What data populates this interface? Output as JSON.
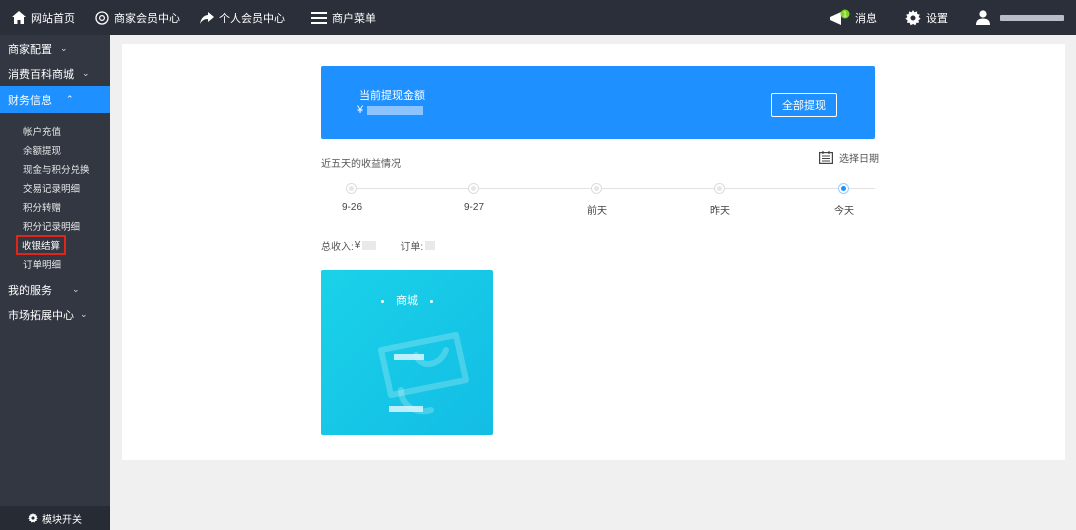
{
  "topbar": {
    "home": "网站首页",
    "merchant_center": "商家会员中心",
    "personal_center": "个人会员中心",
    "merchant_menu": "商户菜单",
    "messages": "消息",
    "settings": "设置"
  },
  "sidebar": {
    "groups": [
      {
        "label": "商家配置"
      },
      {
        "label": "消费百科商城"
      },
      {
        "label": "财务信息"
      },
      {
        "label": "我的服务"
      },
      {
        "label": "市场拓展中心"
      }
    ],
    "finance_items": [
      "帐户充值",
      "余额提现",
      "现金与积分兑换",
      "交易记录明细",
      "积分转赠",
      "积分记录明细",
      "收银结算",
      "订单明细"
    ],
    "module_switch": "模块开关"
  },
  "balance": {
    "label": "当前提现金额",
    "currency": "¥",
    "withdraw_all": "全部提现"
  },
  "earnings": {
    "title": "近五天的收益情况",
    "select_date": "选择日期",
    "days": [
      "9-26",
      "9-27",
      "前天",
      "昨天",
      "今天"
    ],
    "total_label": "总收入:",
    "total_currency": "¥",
    "orders_label": "订单:"
  },
  "mall_card": {
    "title": "商城"
  },
  "colors": {
    "accent": "#1e90ff",
    "topbar": "#2b2f3a",
    "sidebar": "#323742",
    "selected_outline": "#e0251b",
    "card": "#13bde5"
  }
}
